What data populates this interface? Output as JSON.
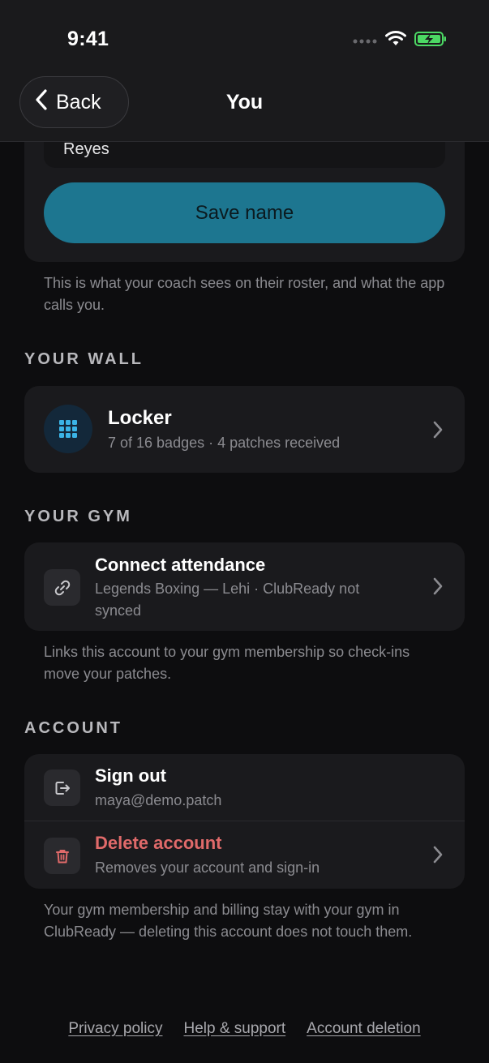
{
  "status": {
    "time": "9:41"
  },
  "nav": {
    "back_label": "Back",
    "title": "You"
  },
  "profile": {
    "last_name_value": "Reyes",
    "save_label": "Save name",
    "helper": "This is what your coach sees on their roster, and what the app calls you."
  },
  "wall": {
    "header": "YOUR WALL",
    "locker_title": "Locker",
    "locker_sub": "7 of 16 badges · 4 patches received"
  },
  "gym": {
    "header": "YOUR GYM",
    "connect_title": "Connect attendance",
    "connect_sub": "Legends Boxing — Lehi · ClubReady not synced",
    "helper": "Links this account to your gym membership so check-ins move your patches."
  },
  "account": {
    "header": "ACCOUNT",
    "signout_title": "Sign out",
    "signout_sub": "maya@demo.patch",
    "delete_title": "Delete account",
    "delete_sub": "Removes your account and sign-in",
    "helper": "Your gym membership and billing stay with your gym in ClubReady — deleting this account does not touch them."
  },
  "footer": {
    "privacy": "Privacy policy",
    "help": "Help & support",
    "deletion": "Account deletion"
  },
  "colors": {
    "accent": "#1d7690",
    "locker_icon": "#3bb4e6",
    "danger": "#e06a6a",
    "battery": "#4cd964"
  }
}
